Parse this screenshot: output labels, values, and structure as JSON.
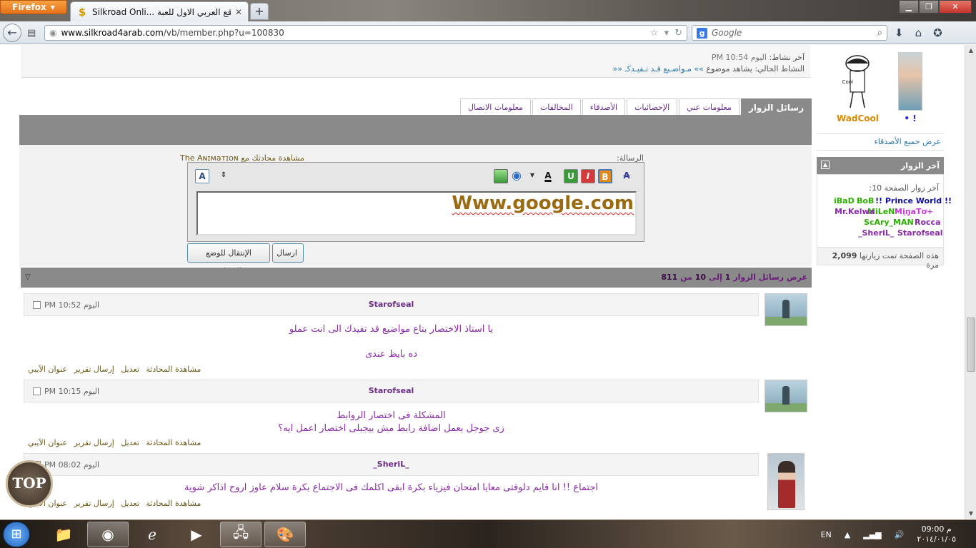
{
  "browser": {
    "menu_label": "Firefox",
    "tab_title": "Silkroad Onli... الموقع العربي الاول للعبة",
    "url_domain": "www.silkroad4arab.com",
    "url_path": "/vb/member.php?u=100830",
    "search_placeholder": "Google"
  },
  "activity": {
    "last_activity_label": "آخر نشاط:",
    "last_activity_value": "اليوم 10:54 PM",
    "current_activity_label": "النشاط الحالي:",
    "current_activity_value": "يشاهد موضوع",
    "current_activity_link": "»» مـواضـيع قـد تـفيـدكـ ««"
  },
  "tabs": [
    {
      "label": "رسائل الزوار",
      "active": true
    },
    {
      "label": "معلومات عني",
      "active": false
    },
    {
      "label": "الإحصائيات",
      "active": false
    },
    {
      "label": "الأصدقاء",
      "active": false
    },
    {
      "label": "المخالفات",
      "active": false
    },
    {
      "label": "معلومات الاتصال",
      "active": false
    }
  ],
  "form": {
    "message_label": "الرسالة:",
    "view_conversation_label": "مشاهدة محادثك مع The Aɴɪмaтɪoɴ",
    "editor_text": "Www.google.com",
    "send_button": "ارسال",
    "advanced_button": "الإنتقال للوضع المتطور"
  },
  "visitor_messages": {
    "header": "عرض رسائل الزوار",
    "range_start": "1",
    "range_word_to": "إلى",
    "range_end": "10",
    "range_word_of": "من",
    "total": "811"
  },
  "messages": [
    {
      "author": "Starofseal",
      "time": "اليوم 10:52 PM",
      "lines": [
        "يا استاذ الاختصار بتاع مواضيع قد تفيدك الى انت عملو",
        "",
        "ده بايظ عندى"
      ]
    },
    {
      "author": "Starofseal",
      "time": "اليوم 10:15 PM",
      "lines": [
        "المشكلة فى اختصار الروابط",
        "زى جوجل بعمل اضافة رابط مش بيجبلى اختصار اعمل ايه؟"
      ]
    },
    {
      "author": "_SheriL_",
      "time": "اليوم 08:02 PM",
      "lines": [
        "اجتماع !! انا قايم دلوقتى معايا امتحان فيزياء بكرة ابقى اكلمك فى الاجتماع بكرة سلام عاوز اروح اذاكر شوية"
      ]
    }
  ],
  "message_actions": [
    "مشاهدة المحادثة",
    "تعديل",
    "إرسال تقرير",
    "عنوان الآيبي"
  ],
  "sidebar": {
    "friends": [
      {
        "name": "WadCool",
        "color": "#d98a00"
      },
      {
        "name": "! •",
        "color": "#2a2ad8"
      }
    ],
    "view_all_friends": "عرض جميع الأصدقاء",
    "visitors_title": "آخر الزوار",
    "visitors_caption": "آخر زوار الصفحة 10:",
    "visitors": [
      {
        "name": "!! Prince World !!",
        "color": "#1010a0"
      },
      {
        "name": "BoB",
        "color": "#2ab000"
      },
      {
        "name": "iBaD",
        "color": "#2ab000"
      },
      {
        "name": "+MįŋaTơ",
        "color": "#c83ad8"
      },
      {
        "name": "MiLeN",
        "color": "#2ab000"
      },
      {
        "name": "Mr.Kelwa",
        "color": "#8a2aa8"
      },
      {
        "name": "Rocca",
        "color": "#8a2aa8"
      },
      {
        "name": "ScAry_MAN",
        "color": "#2ab000"
      },
      {
        "name": "Starofseal",
        "color": "#8a2aa8"
      },
      {
        "name": "_SheriL_",
        "color": "#8a2aa8"
      }
    ],
    "visit_count_prefix": "هذه الصفحة تمت زيارتها",
    "visit_count": "2,099",
    "visit_count_suffix": "مرة"
  },
  "top_badge": "TOP",
  "taskbar": {
    "lang": "EN",
    "time": "09:00 م",
    "date": "٢٠١٤/٠١/٠٥"
  }
}
